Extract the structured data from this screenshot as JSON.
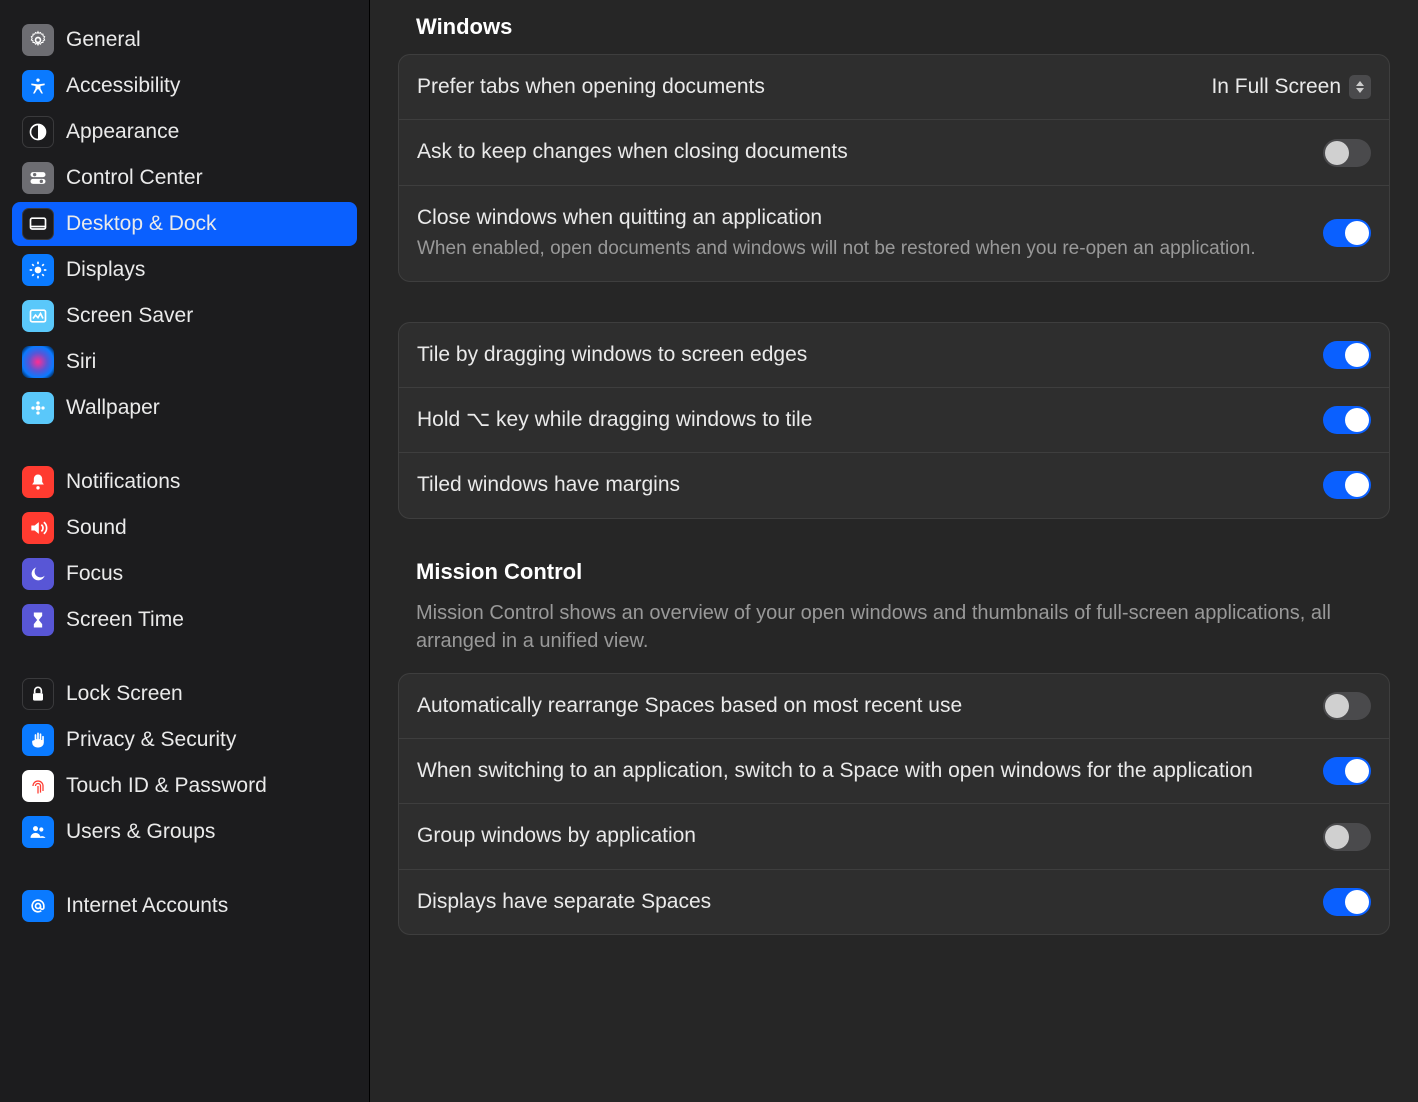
{
  "sidebar": {
    "items": [
      {
        "label": "General"
      },
      {
        "label": "Accessibility"
      },
      {
        "label": "Appearance"
      },
      {
        "label": "Control Center"
      },
      {
        "label": "Desktop & Dock"
      },
      {
        "label": "Displays"
      },
      {
        "label": "Screen Saver"
      },
      {
        "label": "Siri"
      },
      {
        "label": "Wallpaper"
      },
      {
        "label": "Notifications"
      },
      {
        "label": "Sound"
      },
      {
        "label": "Focus"
      },
      {
        "label": "Screen Time"
      },
      {
        "label": "Lock Screen"
      },
      {
        "label": "Privacy & Security"
      },
      {
        "label": "Touch ID & Password"
      },
      {
        "label": "Users & Groups"
      },
      {
        "label": "Internet Accounts"
      }
    ]
  },
  "main": {
    "windows": {
      "header": "Windows",
      "prefer_tabs_label": "Prefer tabs when opening documents",
      "prefer_tabs_value": "In Full Screen",
      "ask_keep_changes": "Ask to keep changes when closing documents",
      "close_quit_label": "Close windows when quitting an application",
      "close_quit_desc": "When enabled, open documents and windows will not be restored when you re-open an application.",
      "tile_edges": "Tile by dragging windows to screen edges",
      "hold_opt_tile": "Hold ⌥ key while dragging windows to tile",
      "tiled_margins": "Tiled windows have margins"
    },
    "mission": {
      "header": "Mission Control",
      "desc": "Mission Control shows an overview of your open windows and thumbnails of full-screen applications, all arranged in a unified view.",
      "auto_rearrange": "Automatically rearrange Spaces based on most recent use",
      "switch_space": "When switching to an application, switch to a Space with open windows for the application",
      "group_windows": "Group windows by application",
      "separate_spaces": "Displays have separate Spaces"
    }
  }
}
